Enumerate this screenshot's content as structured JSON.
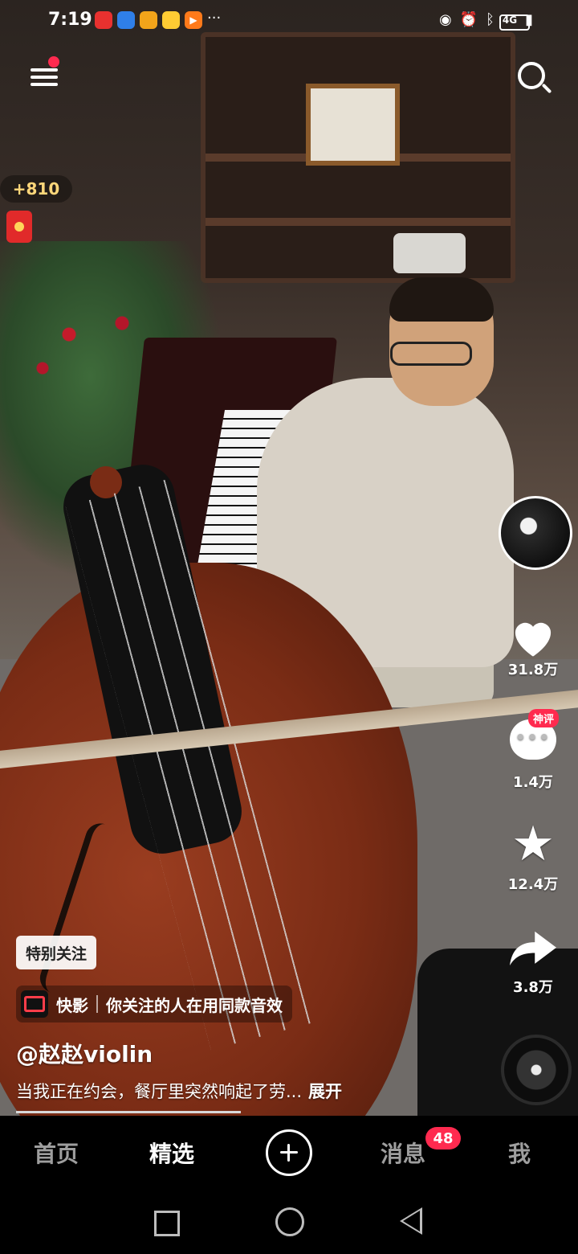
{
  "status_bar": {
    "time": "7:19",
    "network": "4G",
    "icons": [
      "huawei-app-icon",
      "browser-icon",
      "shield-app-icon",
      "game-app-icon",
      "video-app-icon",
      "more-dots",
      "eye-icon",
      "alarm-icon",
      "bluetooth-icon",
      "wifi-icon",
      "signal-icon",
      "battery-icon"
    ]
  },
  "top": {
    "reward_count": "+810"
  },
  "actions": {
    "like_count": "31.8万",
    "comment_badge": "神评",
    "comment_count": "1.4万",
    "favorite_count": "12.4万",
    "share_count": "3.8万"
  },
  "video_info": {
    "special_tag": "特别关注",
    "source_app": "快影",
    "source_text": "你关注的人在用同款音效",
    "username": "@赵赵violin",
    "description": "当我正在约会，餐厅里突然响起了劳...",
    "expand_label": "展开"
  },
  "bottom_nav": {
    "home": "首页",
    "featured": "精选",
    "messages": "消息",
    "messages_badge": "48",
    "me": "我"
  },
  "colors": {
    "accent": "#ff2a4f",
    "reward": "#ffd77a"
  }
}
